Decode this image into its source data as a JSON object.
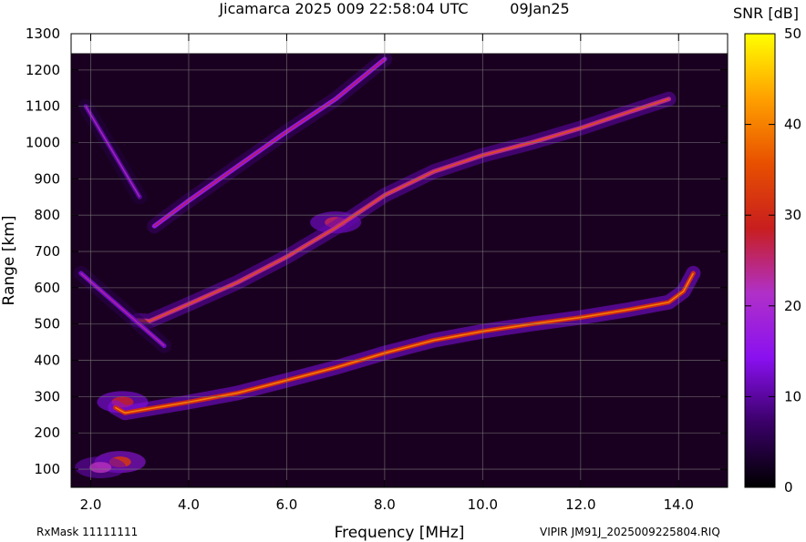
{
  "header": {
    "title": "Jicamarca 2025 009 22:58:04 UTC",
    "date": "09Jan25"
  },
  "footer": {
    "rxmask": "RxMask 11111111",
    "file": "VIPIR  JM91J_2025009225804.RIQ"
  },
  "colorbar": {
    "label": "SNR [dB]",
    "min": 0,
    "max": 50,
    "ticks": [
      "0",
      "10",
      "20",
      "30",
      "40",
      "50"
    ],
    "tick_values": [
      0,
      10,
      20,
      30,
      40,
      50
    ],
    "colors": [
      "#000000",
      "#3a0068",
      "#8a10f0",
      "#b030c8",
      "#c81e1e",
      "#e85000",
      "#ffa000",
      "#ffff00"
    ]
  },
  "chart_data": {
    "type": "heatmap",
    "xlabel": "Frequency [MHz]",
    "ylabel": "Range [km]",
    "xlim": [
      1.6,
      15.0
    ],
    "ylim": [
      50,
      1300
    ],
    "data_top_range_km": 1240,
    "xticks": [
      2,
      4,
      6,
      8,
      10,
      12,
      14
    ],
    "xtick_labels": [
      "2.0",
      "4.0",
      "6.0",
      "8.0",
      "10.0",
      "12.0",
      "14.0"
    ],
    "yticks": [
      100,
      200,
      300,
      400,
      500,
      600,
      700,
      800,
      900,
      1000,
      1100,
      1200,
      1300
    ],
    "ytick_labels": [
      "100",
      "200",
      "300",
      "400",
      "500",
      "600",
      "700",
      "800",
      "900",
      "1000",
      "1100",
      "1200",
      "1300"
    ],
    "grid": true,
    "background": "#1a0020",
    "traces": [
      {
        "name": "",
        "snr_db": 30,
        "points": [
          [
            2.5,
            270
          ],
          [
            2.7,
            255
          ],
          [
            3.0,
            262
          ],
          [
            4.0,
            285
          ],
          [
            5.0,
            310
          ],
          [
            6.0,
            345
          ],
          [
            7.0,
            380
          ],
          [
            8.0,
            420
          ],
          [
            9.0,
            455
          ],
          [
            10.0,
            480
          ],
          [
            11.0,
            500
          ],
          [
            12.0,
            518
          ],
          [
            13.0,
            540
          ],
          [
            13.8,
            560
          ],
          [
            14.1,
            590
          ],
          [
            14.3,
            640
          ]
        ]
      },
      {
        "name": "",
        "snr_db": 24,
        "points": [
          [
            2.95,
            510
          ],
          [
            3.2,
            508
          ],
          [
            4.0,
            555
          ],
          [
            5.0,
            615
          ],
          [
            6.0,
            685
          ],
          [
            7.0,
            765
          ],
          [
            8.0,
            855
          ],
          [
            9.0,
            920
          ],
          [
            10.0,
            965
          ],
          [
            11.0,
            1000
          ],
          [
            12.0,
            1040
          ],
          [
            13.0,
            1085
          ],
          [
            13.8,
            1120
          ]
        ]
      },
      {
        "name": "",
        "snr_db": 16,
        "points": [
          [
            3.3,
            770
          ],
          [
            4.0,
            840
          ],
          [
            5.0,
            935
          ],
          [
            6.0,
            1030
          ],
          [
            7.0,
            1120
          ],
          [
            8.0,
            1230
          ]
        ]
      },
      {
        "name": "",
        "snr_db": 12,
        "points": [
          [
            1.8,
            640
          ],
          [
            3.5,
            440
          ]
        ]
      },
      {
        "name": "",
        "snr_db": 10,
        "points": [
          [
            1.9,
            1100
          ],
          [
            3.0,
            850
          ]
        ]
      }
    ],
    "blobs": [
      {
        "f_mhz": 2.6,
        "range_km": 120,
        "snr_db": 32
      },
      {
        "f_mhz": 2.2,
        "range_km": 105,
        "snr_db": 22
      },
      {
        "f_mhz": 2.65,
        "range_km": 285,
        "snr_db": 28
      },
      {
        "f_mhz": 7.0,
        "range_km": 780,
        "snr_db": 26
      }
    ]
  }
}
